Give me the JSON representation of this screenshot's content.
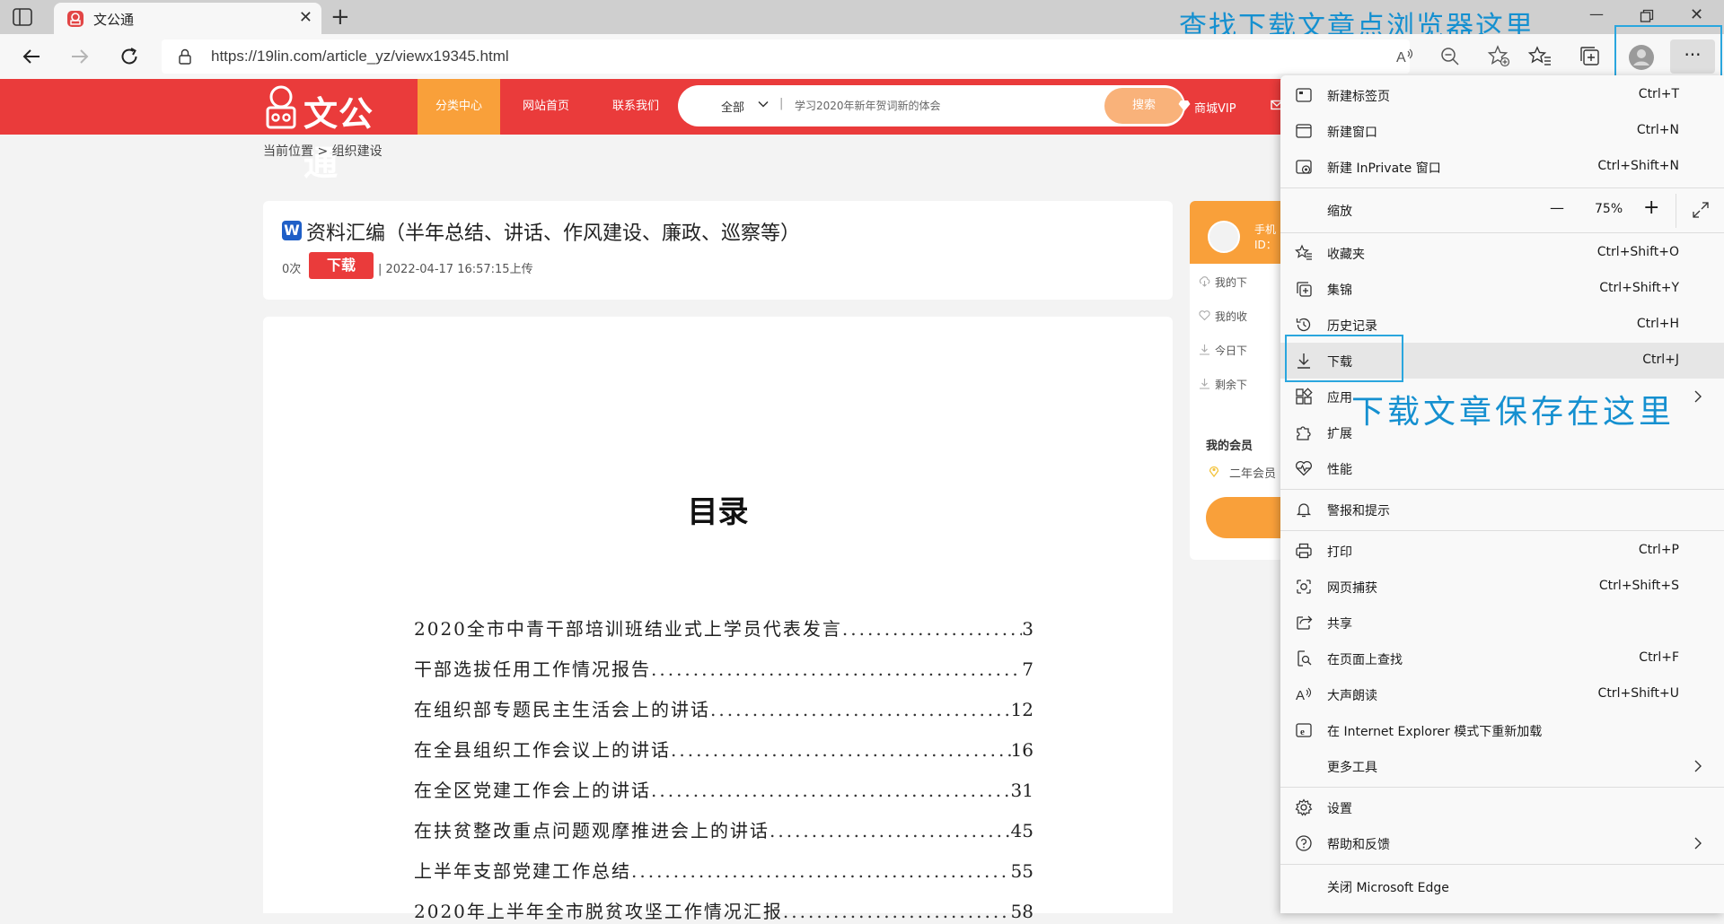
{
  "tab": {
    "title": "文公通"
  },
  "address": {
    "url": "https://19lin.com/article_yz/viewx19345.html"
  },
  "annotations": {
    "top": "查找下载文章点浏览器这里",
    "download": "下载文章保存在这里"
  },
  "site": {
    "logo_text": "文公通",
    "nav": [
      "分类中心",
      "网站首页",
      "联系我们"
    ],
    "search_category": "全部",
    "search_separator": "|",
    "search_placeholder": "学习2020年新年贺词新的体会",
    "search_button": "搜索",
    "vip_label": "商城VIP"
  },
  "breadcrumb": "当前位置 > 组织建设",
  "doc": {
    "type_badge": "W",
    "title": "资料汇编（半年总结、讲话、作风建设、廉政、巡察等）",
    "views": "0次",
    "download_label": "下载",
    "upload": "| 2022-04-17 16:57:15上传",
    "toc_title": "目录",
    "toc": [
      {
        "text": "2020全市中青干部培训班结业式上学员代表发言",
        "page": "3"
      },
      {
        "text": "干部选拔任用工作情况报告",
        "page": "7"
      },
      {
        "text": "在组织部专题民主生活会上的讲话",
        "page": "12"
      },
      {
        "text": "在全县组织工作会议上的讲话",
        "page": "16"
      },
      {
        "text": "在全区党建工作会上的讲话",
        "page": "31"
      },
      {
        "text": "在扶贫整改重点问题观摩推进会上的讲话",
        "page": "45"
      },
      {
        "text": "上半年支部党建工作总结",
        "page": "55"
      },
      {
        "text": "2020年上半年全市脱贫攻坚工作情况汇报",
        "page": "58"
      }
    ]
  },
  "sidebar": {
    "name_line1": "手机",
    "name_line2": "ID：",
    "items": [
      "我的下",
      "我的收",
      "今日下",
      "剩余下"
    ],
    "member_title": "我的会员",
    "member_level": "二年会员"
  },
  "menu": {
    "new_tab": {
      "label": "新建标签页",
      "shortcut": "Ctrl+T"
    },
    "new_window": {
      "label": "新建窗口",
      "shortcut": "Ctrl+N"
    },
    "new_private": {
      "label": "新建 InPrivate 窗口",
      "shortcut": "Ctrl+Shift+N"
    },
    "zoom": {
      "label": "缩放",
      "minus": "—",
      "value": "75%",
      "plus": "+"
    },
    "favorites": {
      "label": "收藏夹",
      "shortcut": "Ctrl+Shift+O"
    },
    "collections": {
      "label": "集锦",
      "shortcut": "Ctrl+Shift+Y"
    },
    "history": {
      "label": "历史记录",
      "shortcut": "Ctrl+H"
    },
    "downloads": {
      "label": "下载",
      "shortcut": "Ctrl+J"
    },
    "apps": {
      "label": "应用"
    },
    "extensions": {
      "label": "扩展"
    },
    "performance": {
      "label": "性能"
    },
    "alerts": {
      "label": "警报和提示"
    },
    "print": {
      "label": "打印",
      "shortcut": "Ctrl+P"
    },
    "capture": {
      "label": "网页捕获",
      "shortcut": "Ctrl+Shift+S"
    },
    "share": {
      "label": "共享"
    },
    "find": {
      "label": "在页面上查找",
      "shortcut": "Ctrl+F"
    },
    "read_aloud": {
      "label": "大声朗读",
      "shortcut": "Ctrl+Shift+U"
    },
    "ie_mode": {
      "label": "在 Internet Explorer 模式下重新加载"
    },
    "more_tools": {
      "label": "更多工具"
    },
    "settings": {
      "label": "设置"
    },
    "help": {
      "label": "帮助和反馈"
    },
    "close": {
      "label": "关闭 Microsoft Edge"
    }
  },
  "colors": {
    "site_red": "#ea3b3b",
    "site_orange": "#f9a03a",
    "annotation_blue": "#1590d0"
  }
}
